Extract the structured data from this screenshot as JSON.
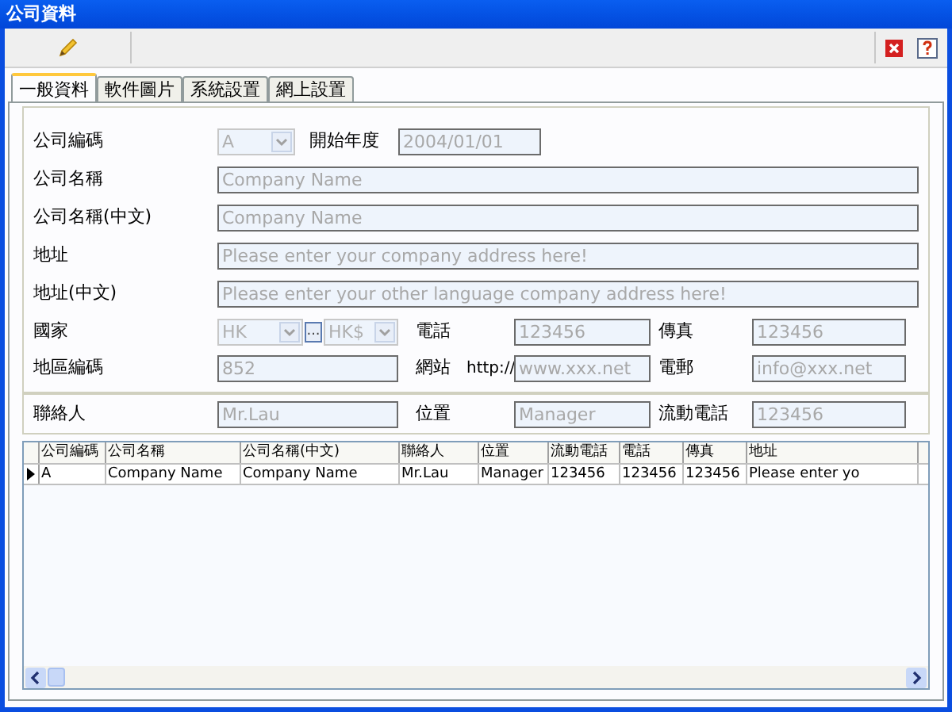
{
  "window": {
    "title": "公司資料"
  },
  "tabs": [
    {
      "label": "一般資料",
      "selected": true
    },
    {
      "label": "軟件圖片",
      "selected": false
    },
    {
      "label": "系統設置",
      "selected": false
    },
    {
      "label": "網上設置",
      "selected": false
    }
  ],
  "form": {
    "company_code": {
      "label": "公司編碼",
      "value": "A",
      "disabled": true
    },
    "start_year": {
      "label": "開始年度",
      "value": "2004/01/01",
      "disabled": true
    },
    "company_name": {
      "label": "公司名稱",
      "value": "Company Name",
      "disabled": true
    },
    "company_name_zh": {
      "label": "公司名稱(中文)",
      "value": "Company Name",
      "disabled": true
    },
    "address": {
      "label": "地址",
      "value": "Please enter your company address here!",
      "disabled": true
    },
    "address_zh": {
      "label": "地址(中文)",
      "value": "Please enter your other language company address here!",
      "disabled": true
    },
    "country": {
      "label": "國家",
      "value": "HK",
      "disabled": true
    },
    "browse_button": {
      "label": "..."
    },
    "currency": {
      "value": "HK$",
      "disabled": true
    },
    "phone": {
      "label": "電話",
      "value": "123456",
      "disabled": true
    },
    "fax": {
      "label": "傳真",
      "value": "123456",
      "disabled": true
    },
    "area_code": {
      "label": "地區編碼",
      "value": "852",
      "disabled": true
    },
    "website": {
      "label": "網站",
      "prefix": "http://",
      "value": "www.xxx.net",
      "disabled": true
    },
    "email": {
      "label": "電郵",
      "value": "info@xxx.net",
      "disabled": true
    },
    "contact": {
      "label": "聯絡人",
      "value": "Mr.Lau",
      "disabled": true
    },
    "position": {
      "label": "位置",
      "value": "Manager",
      "disabled": true
    },
    "mobile": {
      "label": "流動電話",
      "value": "123456",
      "disabled": true
    }
  },
  "table": {
    "columns": [
      "公司編碼",
      "公司名稱",
      "公司名稱(中文)",
      "聯絡人",
      "位置",
      "流動電話",
      "電話",
      "傳真",
      "地址"
    ],
    "rows": [
      {
        "selected": true,
        "cells": [
          "A",
          "Company Name",
          "Company Name",
          "Mr.Lau",
          "Manager",
          "123456",
          "123456",
          "123456",
          "Please enter yo"
        ]
      }
    ]
  }
}
